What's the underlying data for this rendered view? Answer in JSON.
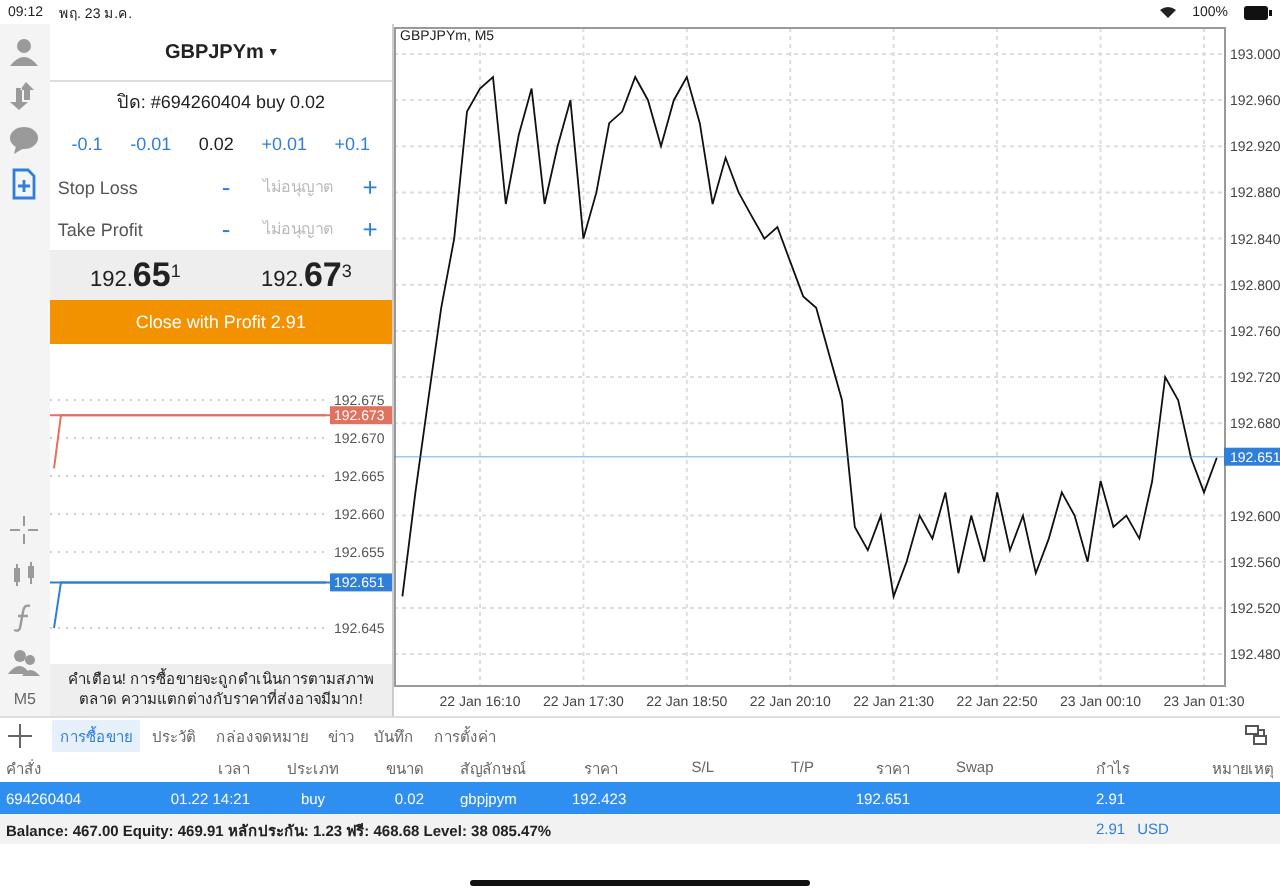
{
  "status_bar": {
    "time": "09:12",
    "date": "พฤ. 23 ม.ค.",
    "battery": "100%"
  },
  "toolbar": {
    "timeframe": "M5",
    "tools": [
      {
        "selected": false
      },
      {
        "selected": false
      },
      {
        "selected": false
      },
      {
        "selected": true
      }
    ]
  },
  "order_panel": {
    "symbol": "GBPJPYm",
    "dropdown": "▾",
    "order_info": "ปิด: #694260404 buy 0.02",
    "volume_steps": [
      {
        "label": "-0.1",
        "kind": "step"
      },
      {
        "label": "-0.01",
        "kind": "step"
      },
      {
        "label": "0.02",
        "kind": "value"
      },
      {
        "label": "+0.01",
        "kind": "step"
      },
      {
        "label": "+0.1",
        "kind": "step"
      }
    ],
    "levels": [
      {
        "label": "Stop Loss",
        "minus": "-",
        "placeholder": "ไม่อนุญาต",
        "plus": "+"
      },
      {
        "label": "Take Profit",
        "minus": "-",
        "placeholder": "ไม่อนุญาต",
        "plus": "+"
      }
    ],
    "bid": "192.**65**$^{1}$",
    "ask": "192.**67**$^{3}$",
    "close_button": "Close with Profit 2.91",
    "tick_chart": {
      "chart_data": {
        "type": "line",
        "categories": [
          null,
          null,
          null,
          null,
          null,
          null,
          null,
          null,
          null,
          null,
          null,
          null,
          null,
          null,
          null,
          null,
          null,
          null,
          null,
          null,
          null,
          null,
          null,
          null,
          null,
          null,
          null,
          null,
          null,
          null,
          null,
          null,
          null,
          null,
          null,
          null,
          null,
          null,
          null,
          null
        ],
        "ylim": [
          192.645,
          192.675
        ],
        "grid": true,
        "series": [
          {
            "color": "#e0725f",
            "values": [
              192.666,
              192.673,
              192.673,
              192.673,
              192.673,
              192.673,
              192.673,
              192.673,
              192.673,
              192.673,
              192.673,
              192.673,
              192.673,
              192.673,
              192.673,
              192.673,
              192.673,
              192.673,
              192.673,
              192.673,
              192.673,
              192.673,
              192.673,
              192.673,
              192.673,
              192.673,
              192.673,
              192.673,
              192.673,
              192.673,
              192.673,
              192.673,
              192.673,
              192.673,
              192.673,
              192.673,
              192.673,
              192.673,
              192.673,
              192.673
            ]
          },
          {
            "color": "#2f7fd8",
            "values": [
              192.645,
              192.651,
              192.651,
              192.651,
              192.651,
              192.651,
              192.651,
              192.651,
              192.651,
              192.651,
              192.651,
              192.651,
              192.651,
              192.651,
              192.651,
              192.651,
              192.651,
              192.651,
              192.651,
              192.651,
              192.651,
              192.651,
              192.651,
              192.651,
              192.651,
              192.651,
              192.651,
              192.651,
              192.651,
              192.651,
              192.651,
              192.651,
              192.651,
              192.651,
              192.651,
              192.651,
              192.651,
              192.651,
              192.651,
              192.651
            ]
          }
        ],
        "yticks": [
          {
            "value": 192.675,
            "label": "192.675"
          },
          {
            "value": 192.67,
            "label": "192.670"
          },
          {
            "value": 192.665,
            "label": "192.665"
          },
          {
            "value": 192.66,
            "label": "192.660"
          },
          {
            "value": 192.655,
            "label": "192.655"
          },
          {
            "value": 192.645,
            "label": "192.645"
          }
        ],
        "ref_lines": [
          {
            "axis": "y",
            "value": 192.673,
            "label": "192.673",
            "color": "#e0725f"
          },
          {
            "axis": "y",
            "value": 192.651,
            "label": "192.651",
            "color": "#2f7fd8"
          }
        ]
      }
    },
    "warning": "คำเตือน! การซื้อขายจะถูกดำเนินการตามสภาพตลาด ความแตกต่างกับราคาที่ส่งอาจมีมาก!"
  },
  "chart": {
    "chart_data": {
      "type": "line",
      "title": "GBPJPYm, M5",
      "categories": [
        null,
        null,
        null,
        null,
        null,
        null,
        "22 Jan 16:10",
        null,
        null,
        null,
        null,
        null,
        null,
        null,
        "22 Jan 17:30",
        null,
        null,
        null,
        null,
        null,
        null,
        null,
        "22 Jan 18:50",
        null,
        null,
        null,
        null,
        null,
        null,
        null,
        "22 Jan 20:10",
        null,
        null,
        null,
        null,
        null,
        null,
        null,
        "22 Jan 21:30",
        null,
        null,
        null,
        null,
        null,
        null,
        null,
        "22 Jan 22:50",
        null,
        null,
        null,
        null,
        null,
        null,
        null,
        "23 Jan 00:10",
        null,
        null,
        null,
        null,
        null,
        null,
        null,
        "23 Jan 01:30",
        null
      ],
      "series": [
        {
          "color": "#111111",
          "values": [
            192.53,
            192.62,
            192.7,
            192.78,
            192.84,
            192.95,
            192.97,
            192.98,
            192.87,
            192.93,
            192.97,
            192.87,
            192.92,
            192.96,
            192.84,
            192.88,
            192.94,
            192.95,
            192.98,
            192.96,
            192.92,
            192.96,
            192.98,
            192.94,
            192.87,
            192.91,
            192.88,
            192.86,
            192.84,
            192.85,
            192.82,
            192.79,
            192.78,
            192.74,
            192.7,
            192.59,
            192.57,
            192.6,
            192.53,
            192.56,
            192.6,
            192.58,
            192.62,
            192.55,
            192.6,
            192.56,
            192.62,
            192.57,
            192.6,
            192.55,
            192.58,
            192.62,
            192.6,
            192.56,
            192.63,
            192.59,
            192.6,
            192.58,
            192.63,
            192.72,
            192.7,
            192.65,
            192.62,
            192.65
          ]
        }
      ],
      "ylim": [
        192.4523,
        193.0225
      ],
      "grid": true,
      "yticks": [
        {
          "value": 193.0,
          "label": "193.000"
        },
        {
          "value": 192.96,
          "label": "192.960"
        },
        {
          "value": 192.92,
          "label": "192.920"
        },
        {
          "value": 192.88,
          "label": "192.880"
        },
        {
          "value": 192.84,
          "label": "192.840"
        },
        {
          "value": 192.8,
          "label": "192.800"
        },
        {
          "value": 192.76,
          "label": "192.760"
        },
        {
          "value": 192.72,
          "label": "192.720"
        },
        {
          "value": 192.68,
          "label": "192.680"
        },
        {
          "value": 192.6,
          "label": "192.600"
        },
        {
          "value": 192.56,
          "label": "192.560"
        },
        {
          "value": 192.52,
          "label": "192.520"
        },
        {
          "value": 192.48,
          "label": "192.480"
        }
      ],
      "ref_lines": [
        {
          "axis": "y",
          "value": 192.651,
          "label": "192.651",
          "color": "#2f7fd8"
        }
      ]
    }
  },
  "tabs": [
    {
      "label": "การซื้อขาย",
      "selected": true
    },
    {
      "label": "ประวัติ",
      "selected": false
    },
    {
      "label": "กล่องจดหมาย",
      "selected": false
    },
    {
      "label": "ข่าว",
      "selected": false
    },
    {
      "label": "บันทึก",
      "selected": false
    },
    {
      "label": "การตั้งค่า",
      "selected": false
    }
  ],
  "table": {
    "columns": [
      "คำสั่ง",
      "เวลา",
      "ประเภท",
      "ขนาด",
      "สัญลักษณ์",
      "ราคา",
      "S/L",
      "T/P",
      "ราคา",
      "Swap",
      "กำไร",
      "หมายเหตุ"
    ],
    "rows": [
      {
        "selected": true,
        "cells": [
          "694260404",
          "01.22 14:21",
          "buy",
          "0.02",
          "gbpjpym",
          "192.423",
          null,
          null,
          "192.651",
          null,
          "2.91",
          null
        ]
      }
    ]
  },
  "summary": {
    "text": "Balance: 467.00 Equity: 469.91 หลักประกัน: 1.23 ฟรี: 468.68 Level: 38 085.47%",
    "profit": "2.91",
    "currency": "USD"
  }
}
